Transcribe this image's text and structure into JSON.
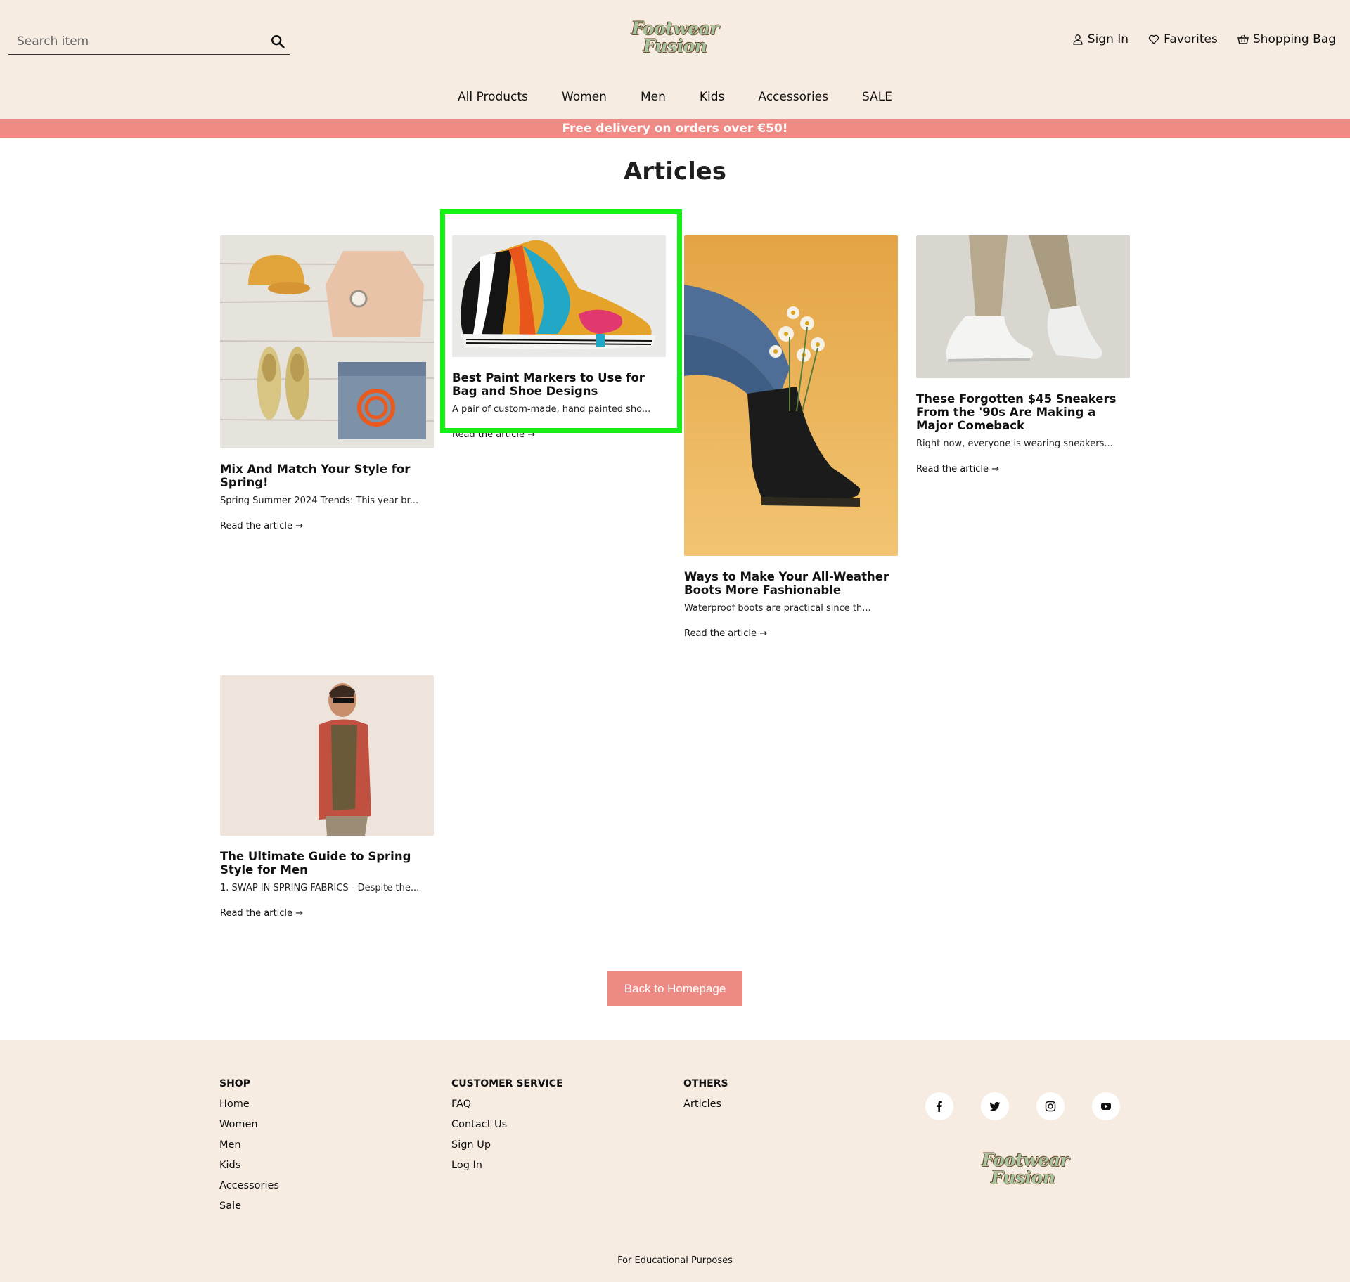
{
  "header": {
    "search_placeholder": "Search item",
    "logo_line1": "Footwear",
    "logo_line2": "Fusion",
    "user_nav": {
      "sign_in": "Sign In",
      "favorites": "Favorites",
      "bag": "Shopping Bag"
    },
    "main_nav": [
      "All Products",
      "Women",
      "Men",
      "Kids",
      "Accessories",
      "SALE"
    ]
  },
  "banner": "Free delivery on orders over €50!",
  "page_title": "Articles",
  "articles": [
    {
      "title": "Mix And Match Your Style for Spring!",
      "excerpt": "Spring Summer 2024 Trends: This year br...",
      "link": "Read the article"
    },
    {
      "title": "Best Paint Markers to Use for Bag and Shoe Designs",
      "excerpt": "A pair of custom-made, hand painted sho...",
      "link": "Read the article"
    },
    {
      "title": "Ways to Make Your All-Weather Boots More Fashionable",
      "excerpt": "Waterproof boots are practical since th...",
      "link": "Read the article"
    },
    {
      "title": "These Forgotten $45 Sneakers From the '90s Are Making a Major Comeback",
      "excerpt": "Right now, everyone is wearing sneakers...",
      "link": "Read the article"
    },
    {
      "title": "The Ultimate Guide to Spring Style for Men",
      "excerpt": "1. SWAP IN SPRING FABRICS - Despite the...",
      "link": "Read the article"
    }
  ],
  "back_button": "Back to Homepage",
  "footer": {
    "shop": {
      "heading": "SHOP",
      "links": [
        "Home",
        "Women",
        "Men",
        "Kids",
        "Accessories",
        "Sale"
      ]
    },
    "customer_service": {
      "heading": "CUSTOMER SERVICE",
      "links": [
        "FAQ",
        "Contact Us",
        "Sign Up",
        "Log In"
      ]
    },
    "others": {
      "heading": "OTHERS",
      "links": [
        "Articles"
      ]
    },
    "social": [
      "facebook-icon",
      "twitter-icon",
      "instagram-icon",
      "youtube-icon"
    ],
    "bottom_text": "For Educational Purposes"
  },
  "colors": {
    "accent": "#f08a84",
    "header_bg": "#f6ece2",
    "highlight": "#15f015"
  }
}
